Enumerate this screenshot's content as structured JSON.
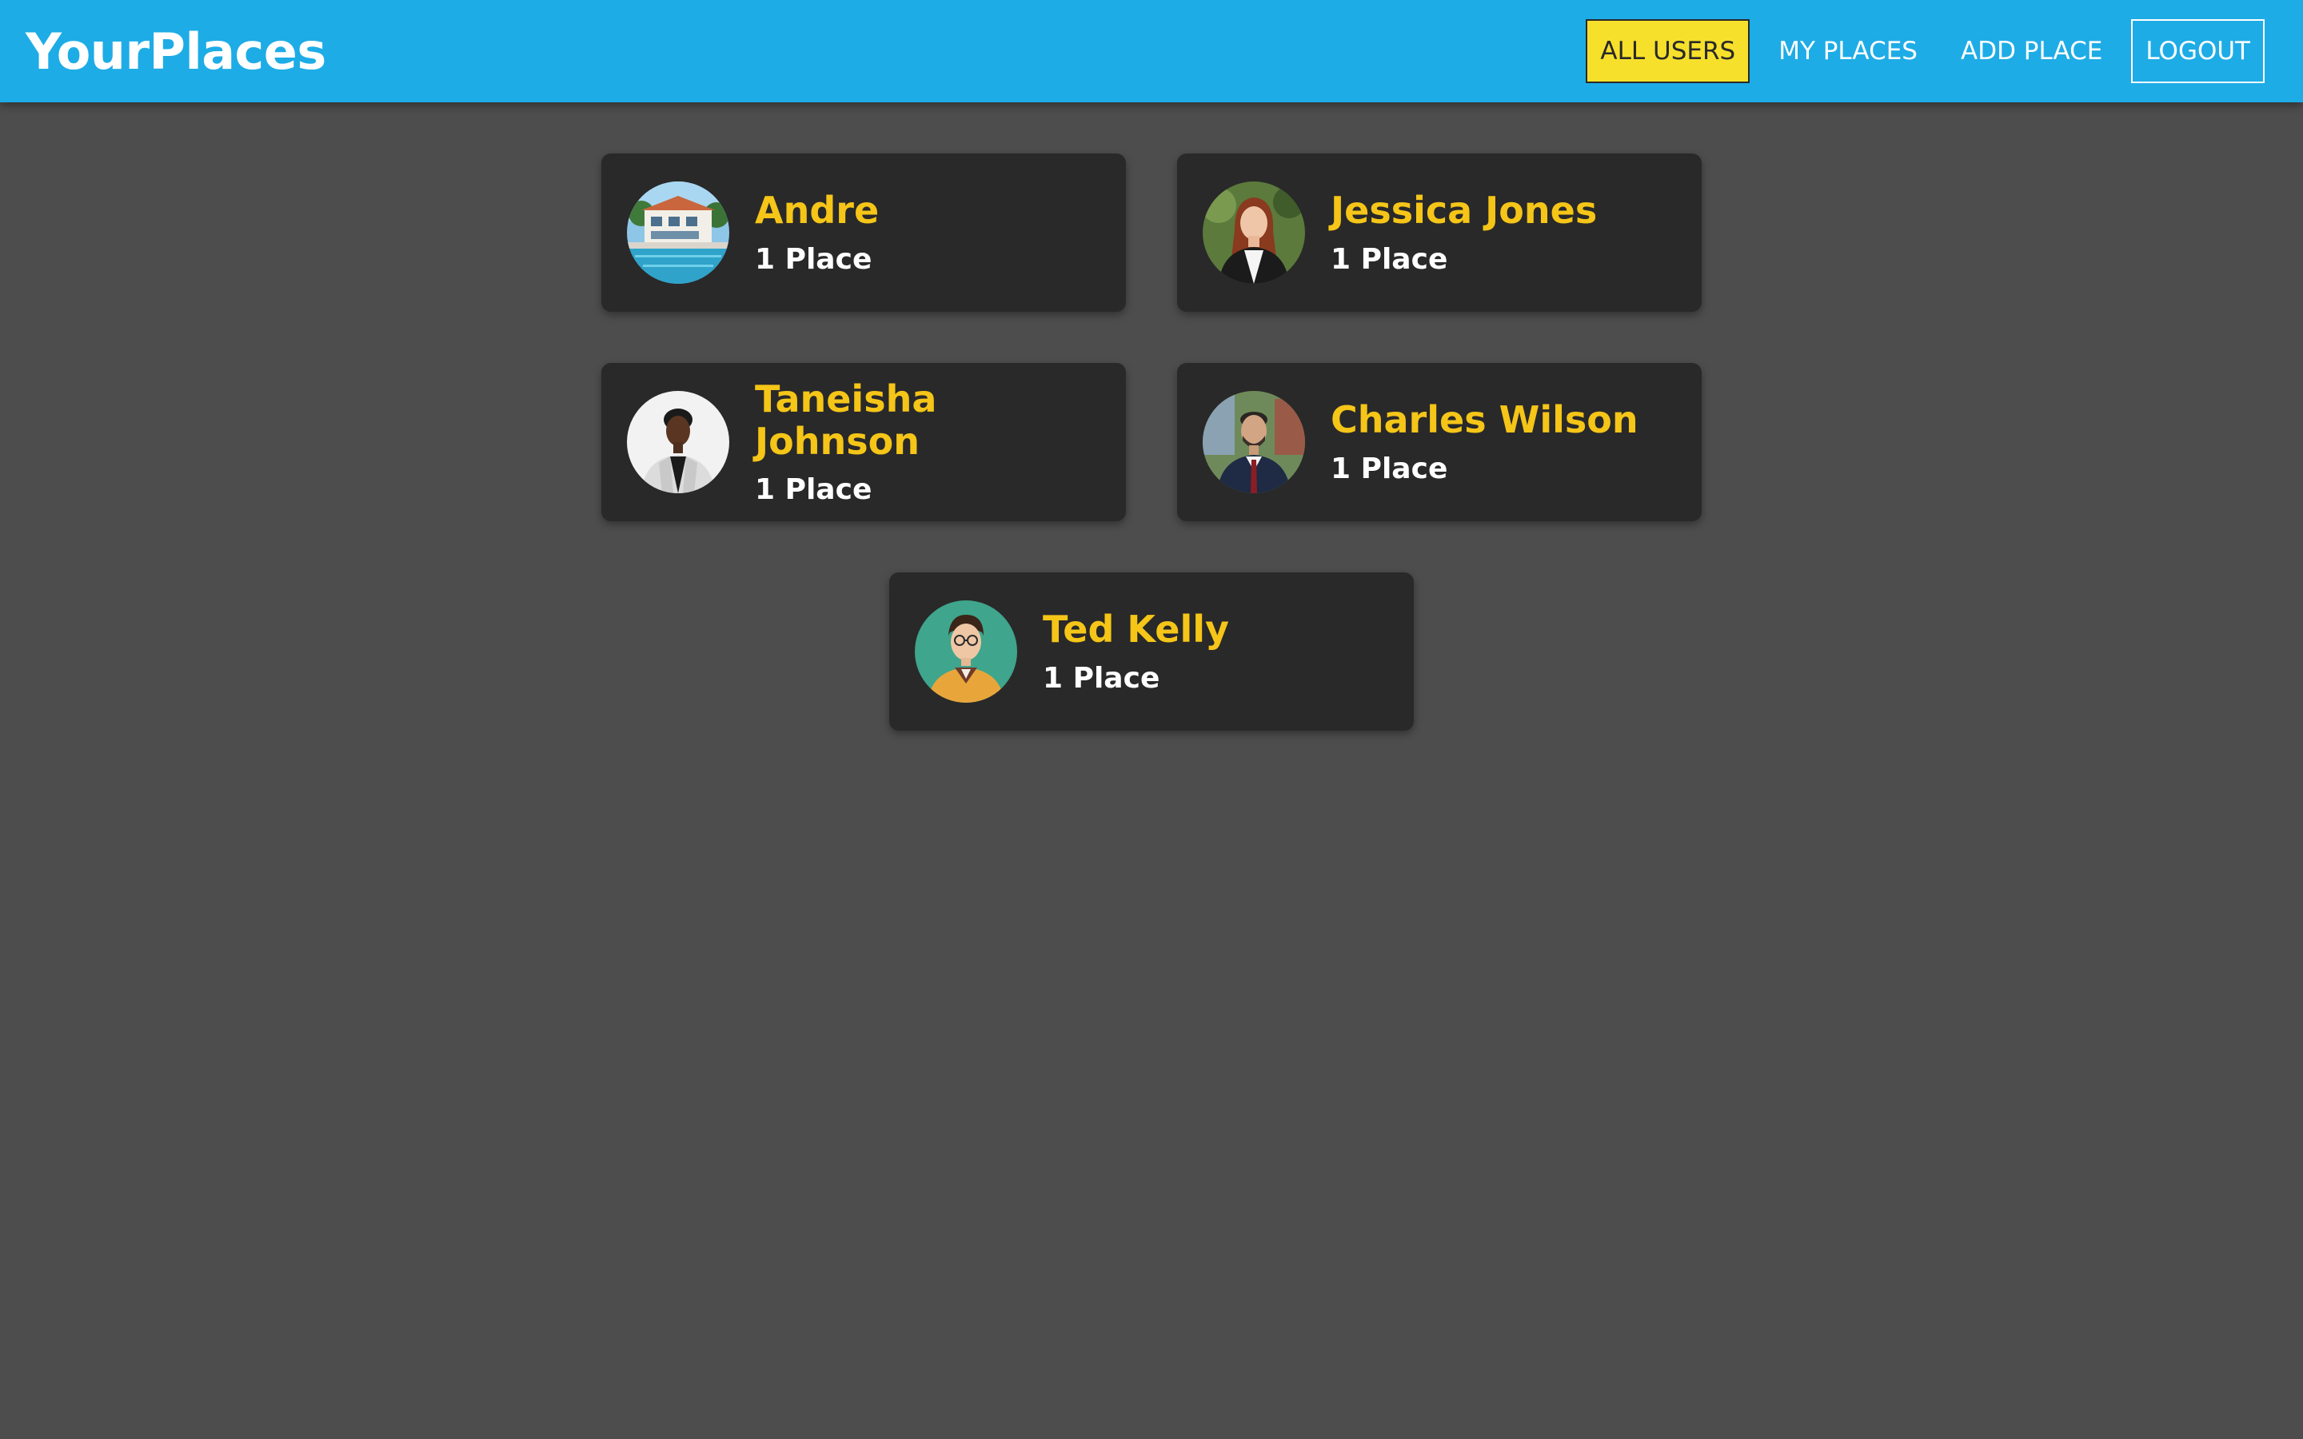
{
  "header": {
    "brand": "YourPlaces",
    "nav": [
      {
        "label": "ALL USERS"
      },
      {
        "label": "MY PLACES"
      },
      {
        "label": "ADD PLACE"
      },
      {
        "label": "LOGOUT"
      }
    ]
  },
  "users": [
    {
      "name": "Andre",
      "places": "1 Place",
      "avatar": "house-with-pool-photo"
    },
    {
      "name": "Jessica Jones",
      "places": "1 Place",
      "avatar": "woman-portrait-photo"
    },
    {
      "name": "Taneisha Johnson",
      "places": "1 Place",
      "avatar": "woman-portrait-photo"
    },
    {
      "name": "Charles Wilson",
      "places": "1 Place",
      "avatar": "man-portrait-photo"
    },
    {
      "name": "Ted Kelly",
      "places": "1 Place",
      "avatar": "illustrated-man-portrait"
    }
  ],
  "colors": {
    "header_bg": "#1eace6",
    "page_bg": "#4d4d4d",
    "card_bg": "#292929",
    "name_color": "#f5c518",
    "active_nav_bg": "#f7e02b"
  }
}
